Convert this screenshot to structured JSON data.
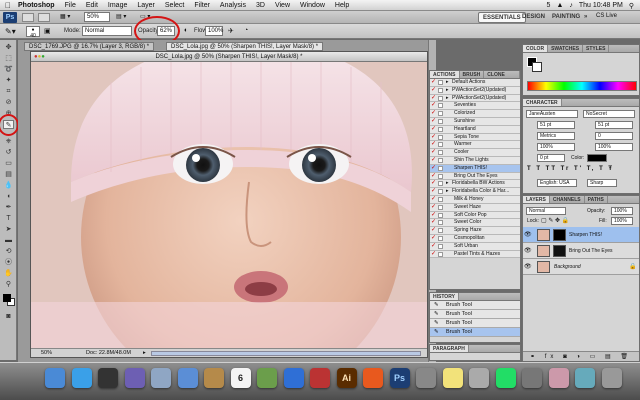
{
  "menubar": {
    "apple": "",
    "items": [
      "Photoshop",
      "File",
      "Edit",
      "Image",
      "Layer",
      "Select",
      "Filter",
      "Analysis",
      "3D",
      "View",
      "Window",
      "Help"
    ],
    "clock": "Thu 10:48 PM",
    "battery": "5"
  },
  "appbar": {
    "logo": "Ps",
    "zoom": "50%",
    "essentials": "ESSENTIALS",
    "design": "DESIGN",
    "painting": "PAINTING",
    "more": "»",
    "cs_live": "CS Live"
  },
  "options": {
    "brush_size": "40",
    "mode_label": "Mode:",
    "mode_value": "Normal",
    "opacity_label": "Opacity:",
    "opacity_value": "62%",
    "flow_label": "Flow:",
    "flow_value": "100%"
  },
  "doc": {
    "tab1": "DSC_1769.JPG @ 16.7% (Layer 3, RGB/8) *",
    "tab2": "DSC_Lola.jpg @ 50% (Sharpen THIS!, Layer Mask/8) *",
    "title": "DSC_Lola.jpg @ 50% (Sharpen THIS!, Layer Mask/8) *",
    "zoom": "50%",
    "docsize": "Doc: 22.8M/48.0M"
  },
  "actions": {
    "tabs": [
      "ACTIONS",
      "BRUSH",
      "CLONE SOURCE"
    ],
    "rows": [
      {
        "label": "Default Actions",
        "folder": true
      },
      {
        "label": "PWActionSet2(Updated)",
        "folder": true
      },
      {
        "label": "PWActionSet2(Updated)",
        "folder": true
      },
      {
        "label": "Seventies"
      },
      {
        "label": "Colorized"
      },
      {
        "label": "Sunshine"
      },
      {
        "label": "Heartland"
      },
      {
        "label": "Sepia Tone"
      },
      {
        "label": "Warmer"
      },
      {
        "label": "Cooler"
      },
      {
        "label": "Shin The Lights"
      },
      {
        "label": "Sharpen THIS!",
        "selected": true
      },
      {
        "label": "Bring Out The Eyes"
      },
      {
        "label": "Floridabella BW Actions",
        "folder": true
      },
      {
        "label": "Floridabella Color & Har...",
        "folder": true
      },
      {
        "label": "Milk & Honey"
      },
      {
        "label": "Sweet Haze"
      },
      {
        "label": "Soft Color Pop"
      },
      {
        "label": "Sweet Color"
      },
      {
        "label": "Spring Haze"
      },
      {
        "label": "Cosmopolitan"
      },
      {
        "label": "Soft Urban"
      },
      {
        "label": "Pastel Tints & Hazes"
      }
    ]
  },
  "history": {
    "title": "HISTORY",
    "rows": [
      "Brush Tool",
      "Brush Tool",
      "Brush Tool",
      "Brush Tool"
    ],
    "selected_index": 3
  },
  "paragraph": {
    "title": "PARAGRAPH"
  },
  "color": {
    "tabs": [
      "COLOR",
      "SWATCHES",
      "STYLES"
    ],
    "fg": "#000000",
    "bg": "#ffffff"
  },
  "character": {
    "title": "CHARACTER",
    "font": "JaneAusten",
    "style": "NoSecret",
    "size": "51 pt",
    "leading": "51 pt",
    "kern": "Metrics",
    "tracking": "0",
    "vscale": "100%",
    "hscale": "100%",
    "baseline": "0 pt",
    "color_label": "Color:",
    "language": "English: USA",
    "aa": "Sharp"
  },
  "layers": {
    "tabs": [
      "LAYERS",
      "CHANNELS",
      "PATHS"
    ],
    "blend": "Normal",
    "opacity_label": "Opacity:",
    "opacity": "100%",
    "lock_label": "Lock:",
    "fill_label": "Fill:",
    "fill": "100%",
    "rows": [
      {
        "name": "Sharpen THIS!",
        "selected": true
      },
      {
        "name": "Bring Out The Eyes"
      },
      {
        "name": "Background"
      }
    ]
  },
  "colors": {
    "red_annotation": "#d41414",
    "selection": "#a7c4ee",
    "ps_blue": "#1c3e73"
  },
  "dock": {
    "icons": [
      "finder-icon",
      "app-store-icon",
      "dashboard-icon",
      "mission-control-icon",
      "preview-icon",
      "mail-icon",
      "contacts-icon",
      "calendar-icon",
      "iphoto-icon",
      "itunes-icon",
      "photo-booth-icon",
      "illustrator-icon",
      "firefox-icon",
      "photoshop-icon",
      "utility-icon",
      "notes-icon",
      "cd-icon",
      "time-machine-icon",
      "preferences-icon",
      "photo-stack-icon",
      "folder-icon",
      "trash-icon"
    ],
    "calendar_day": "6",
    "illustrator": "Ai",
    "photoshop": "Ps"
  }
}
